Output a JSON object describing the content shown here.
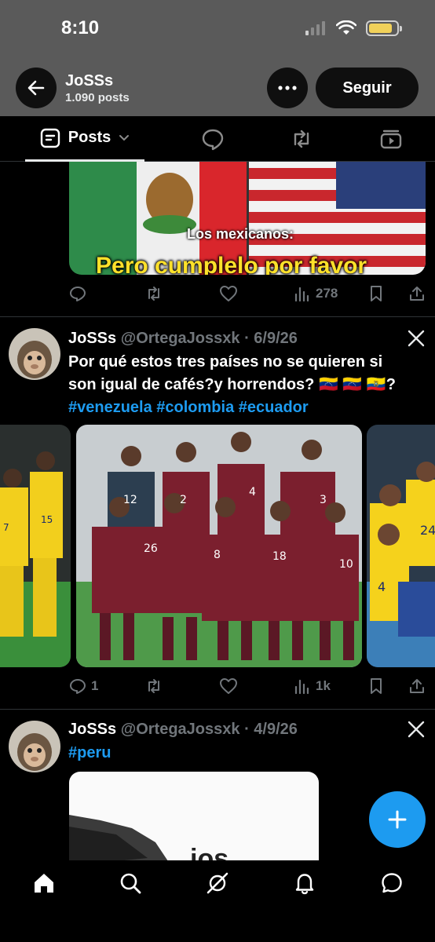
{
  "status": {
    "time": "8:10",
    "battery_level": 0.85
  },
  "header": {
    "name": "JoSSs",
    "posts_count": "1.090 posts",
    "follow_label": "Seguir"
  },
  "tabs": {
    "active_label": "Posts"
  },
  "post1": {
    "image_caption_small": "Los mexicanos:",
    "image_caption_big": "Pero cumplelo por favor",
    "views": "278"
  },
  "post2": {
    "name": "JoSSs",
    "handle": "@OrtegaJossxk · 6/9/26",
    "text": "Por qué estos tres países no se quieren si son igual de cafés?y horrendos? 🇻🇪 🇻🇪 🇪🇨?",
    "hashtags": "#venezuela #colombia #ecuador",
    "replies": "1",
    "views": "1k",
    "jersey_numbers": [
      "12",
      "2",
      "4",
      "3",
      "26",
      "8",
      "18",
      "10",
      "15",
      "7",
      "24",
      "4"
    ]
  },
  "post3": {
    "name": "JoSSs",
    "handle": "@OrtegaJossxk · 4/9/26",
    "hashtags": "#peru",
    "image_text": "jos"
  },
  "colors": {
    "accent": "#1d9bf0",
    "background": "#000000",
    "header_bg": "#5a5a5a"
  }
}
